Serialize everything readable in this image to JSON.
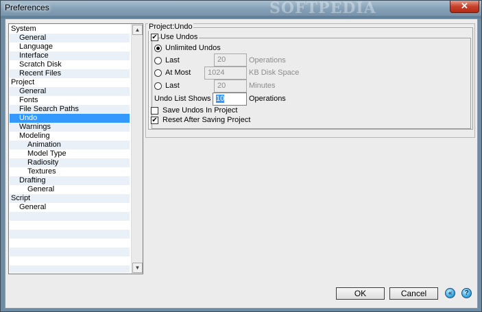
{
  "window": {
    "title": "Preferences",
    "watermark": "SOFTPEDIA",
    "close_glyph": "✕"
  },
  "tree": {
    "items": [
      {
        "label": "System",
        "level": 0
      },
      {
        "label": "General",
        "level": 1
      },
      {
        "label": "Language",
        "level": 1
      },
      {
        "label": "Interface",
        "level": 1
      },
      {
        "label": "Scratch Disk",
        "level": 1
      },
      {
        "label": "Recent Files",
        "level": 1
      },
      {
        "label": "Project",
        "level": 0
      },
      {
        "label": "General",
        "level": 1
      },
      {
        "label": "Fonts",
        "level": 1
      },
      {
        "label": "File Search Paths",
        "level": 1
      },
      {
        "label": "Undo",
        "level": 1,
        "selected": true
      },
      {
        "label": "Warnings",
        "level": 1
      },
      {
        "label": "Modeling",
        "level": 1
      },
      {
        "label": "Animation",
        "level": 2
      },
      {
        "label": "Model Type",
        "level": 2
      },
      {
        "label": "Radiosity",
        "level": 2
      },
      {
        "label": "Textures",
        "level": 2
      },
      {
        "label": "Drafting",
        "level": 1
      },
      {
        "label": "General",
        "level": 2
      },
      {
        "label": "Script",
        "level": 0
      },
      {
        "label": "General",
        "level": 1
      }
    ],
    "empty_rows": 7,
    "scroll_up": "▲",
    "scroll_down": "▼"
  },
  "panel": {
    "title": "Project:Undo",
    "use_undos": {
      "label": "Use Undos",
      "checked": true
    },
    "unlimited": {
      "label": "Unlimited Undos",
      "selected": true
    },
    "last_ops": {
      "label": "Last",
      "value": "20",
      "unit": "Operations"
    },
    "at_most": {
      "label": "At Most",
      "value": "1024",
      "unit": "KB Disk Space"
    },
    "last_minutes": {
      "label": "Last",
      "value": "20",
      "unit": "Minutes"
    },
    "undo_list": {
      "label": "Undo List Shows",
      "value": "10",
      "unit": "Operations"
    },
    "save_undos": {
      "label": "Save Undos In Project",
      "checked": false
    },
    "reset_after": {
      "label": "Reset After Saving Project",
      "checked": true
    }
  },
  "footer": {
    "ok": "OK",
    "cancel": "Cancel",
    "back_icon": "«",
    "help_icon": "?"
  },
  "check_mark": "✔"
}
